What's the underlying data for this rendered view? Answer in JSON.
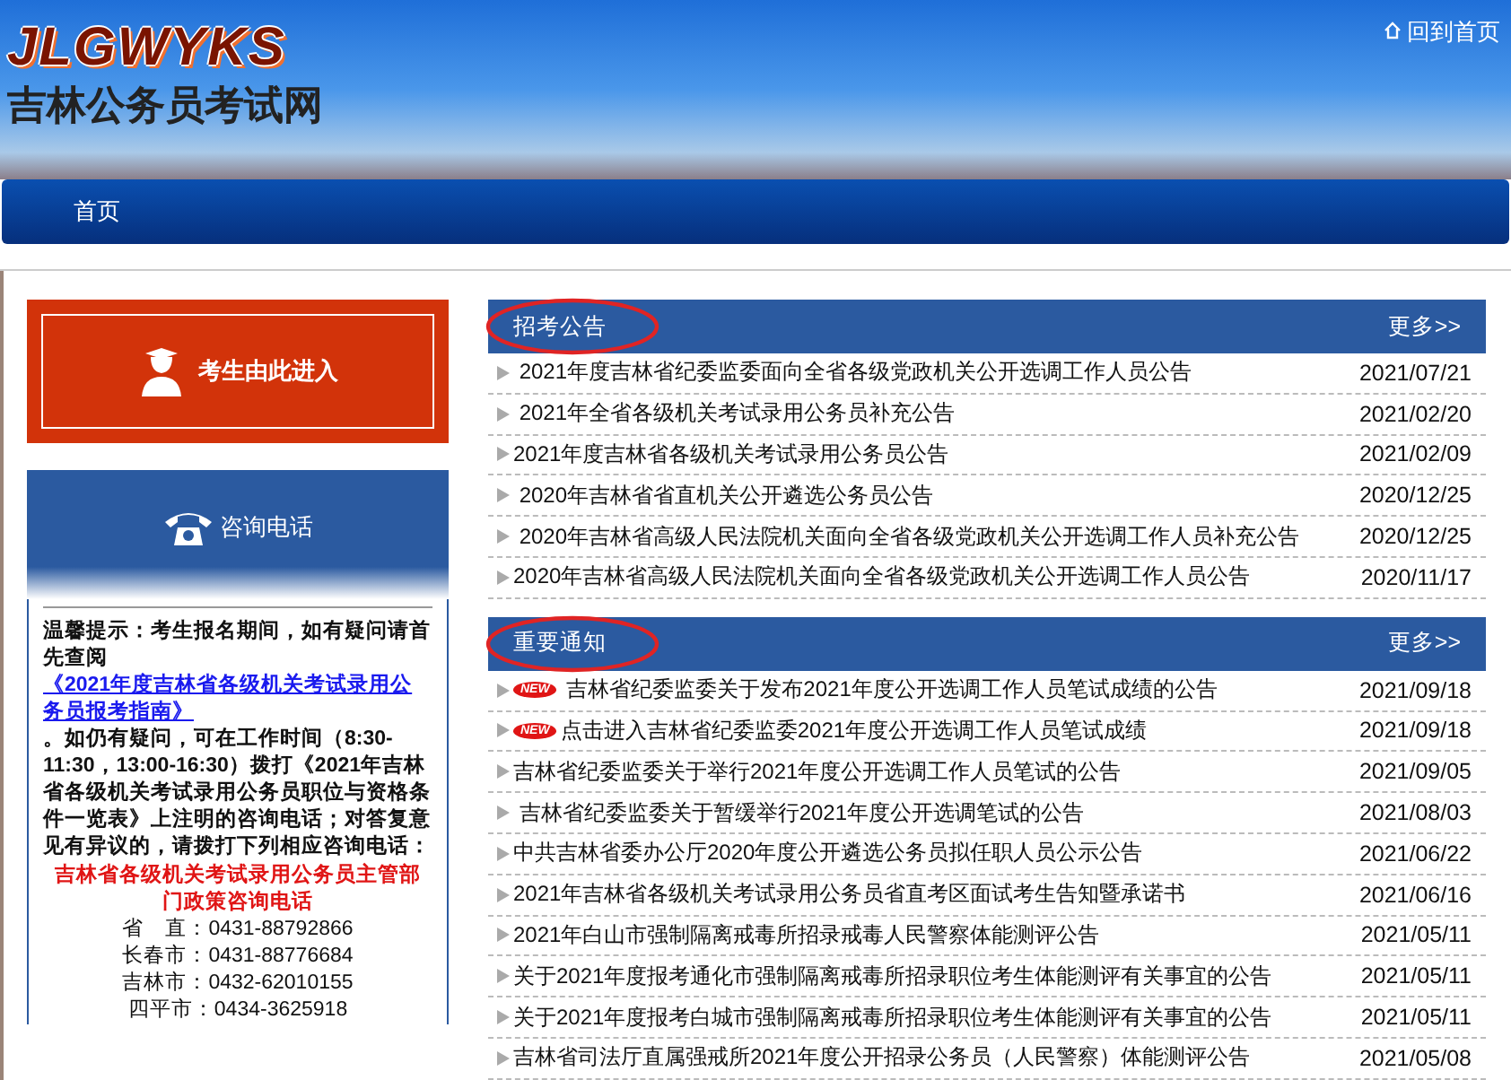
{
  "header": {
    "logo": "JLGWYKS",
    "site_name": "吉林公务员考试网",
    "home_link": "回到首页"
  },
  "nav": {
    "items": [
      {
        "label": "首页",
        "selected": false
      }
    ]
  },
  "sidebar": {
    "enter_button": "考生由此进入",
    "consult_title": "咨询电话",
    "notice": "温馨提示：考生报名期间，如有疑问请首先查阅",
    "notice_link": "《2021年度吉林省各级机关考试录用公务员报考指南》",
    "notice_rest": "。如仍有疑问，可在工作时间（8:30-11:30，13:00-16:30）拨打《2021年吉林省各级机关考试录用公务员职位与资格条件一览表》上注明的咨询电话；对答复意见有异议的，请拨打下列相应咨询电话：",
    "phone_heading": "吉林省各级机关考试录用公务员主管部门政策咨询电话",
    "phones": [
      {
        "city": "省　直：",
        "number": "0431-88792866"
      },
      {
        "city": "长春市：",
        "number": "0431-88776684"
      },
      {
        "city": "吉林市：",
        "number": "0432-62010155"
      },
      {
        "city": "四平市：",
        "number": "0434-3625918"
      }
    ]
  },
  "sections": [
    {
      "title": "招考公告",
      "more": "更多>>",
      "items": [
        {
          "title": " 2021年度吉林省纪委监委面向全省各级党政机关公开选调工作人员公告",
          "date": "2021/07/21"
        },
        {
          "title": " 2021年全省各级机关考试录用公务员补充公告",
          "date": "2021/02/20"
        },
        {
          "title": "2021年度吉林省各级机关考试录用公务员公告",
          "date": "2021/02/09"
        },
        {
          "title": " 2020年吉林省省直机关公开遴选公务员公告",
          "date": "2020/12/25"
        },
        {
          "title": " 2020年吉林省高级人民法院机关面向全省各级党政机关公开选调工作人员补充公告",
          "date": "2020/12/25"
        },
        {
          "title": "2020年吉林省高级人民法院机关面向全省各级党政机关公开选调工作人员公告",
          "date": "2020/11/17"
        }
      ]
    },
    {
      "title": "重要通知",
      "more": "更多>>",
      "items": [
        {
          "title": " 吉林省纪委监委关于发布2021年度公开选调工作人员笔试成绩的公告",
          "date": "2021/09/18",
          "badge": "NEW"
        },
        {
          "title": "点击进入吉林省纪委监委2021年度公开选调工作人员笔试成绩",
          "date": "2021/09/18",
          "badge": "NEW"
        },
        {
          "title": "吉林省纪委监委关于举行2021年度公开选调工作人员笔试的公告",
          "date": "2021/09/05"
        },
        {
          "title": " 吉林省纪委监委关于暂缓举行2021年度公开选调笔试的公告",
          "date": "2021/08/03"
        },
        {
          "title": "中共吉林省委办公厅2020年度公开遴选公务员拟任职人员公示公告",
          "date": "2021/06/22"
        },
        {
          "title": "2021年吉林省各级机关考试录用公务员省直考区面试考生告知暨承诺书",
          "date": "2021/06/16"
        },
        {
          "title": "2021年白山市强制隔离戒毒所招录戒毒人民警察体能测评公告",
          "date": "2021/05/11"
        },
        {
          "title": "关于2021年度报考通化市强制隔离戒毒所招录职位考生体能测评有关事宜的公告",
          "date": "2021/05/11"
        },
        {
          "title": "关于2021年度报考白城市强制隔离戒毒所招录职位考生体能测评有关事宜的公告",
          "date": "2021/05/11"
        },
        {
          "title": "吉林省司法厅直属强戒所2021年度公开招录公务员（人民警察）体能测评公告",
          "date": "2021/05/08"
        }
      ]
    }
  ]
}
